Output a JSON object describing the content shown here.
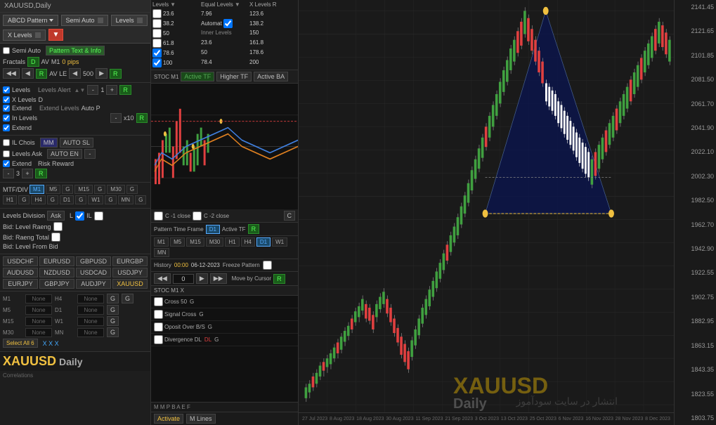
{
  "title": "XAUUSD,Daily",
  "toolbar": {
    "abcd_label": "ABCD Pattern",
    "semi_auto_label": "Semi Auto",
    "levels_label": "Levels",
    "x_levels_label": "X Levels"
  },
  "controls": {
    "semi_auto": "Semi Auto",
    "pattern_text": "Pattern Text & Info",
    "fractals": "Fractals",
    "fractals_d": "D",
    "av": "AV",
    "m1": "M1",
    "pips": "0 pips",
    "av_le": "AV LE",
    "av_le_val": "500",
    "levels": "Levels",
    "x_levels": "X Levels",
    "extend": "Extend",
    "in_levels": "In Levels",
    "extend2": "Extend",
    "il_chois": "IL Chois",
    "levels_ask": "Levels Ask",
    "extend3": "Extend",
    "levels_alert": "Levels Alert",
    "extend_levels": "Extend Levels",
    "auto_p": "Auto P",
    "mtf_div": "MTF/DIV",
    "m1_tf": "M1",
    "m5_tf": "M5",
    "m15_tf": "M15",
    "m30_tf": "M30",
    "h1_tf": "H1",
    "h4_tf": "H4",
    "d1_tf": "D1",
    "w1_tf": "W1",
    "mn_tf": "MN",
    "g_label": "G"
  },
  "levels_data": {
    "col1_header": "Levels",
    "col2_header": "Equal Levels",
    "col3_header": "X Levels",
    "col1_r": "R",
    "rows": [
      {
        "v1": "23.6",
        "v2": "7.96",
        "v3": "123.6"
      },
      {
        "v1": "38.2",
        "v2": "Automat",
        "v3": "138.2"
      },
      {
        "v1": "50",
        "v2": "",
        "v3": "150"
      },
      {
        "v1": "61.8",
        "v2": "23.6",
        "v3": "161.8"
      },
      {
        "v1": "78.6",
        "v2": "50",
        "v3": "178.6"
      },
      {
        "v1": "100",
        "v2": "78.4",
        "v3": "200"
      }
    ],
    "inner_levels": "Inner Levels"
  },
  "stoc": {
    "label": "STOC M1",
    "active_tf": "Active TF",
    "higher_tf": "Higher TF",
    "active_ba": "Active BA",
    "cross50": "Cross 50",
    "signal_cross": "Signal Cross",
    "oposit": "Oposit Over B/S",
    "divergence": "Divergence DL"
  },
  "pattern_tf": {
    "label": "Pattern Time Frame",
    "d1": "D1",
    "active_tf": "Active TF",
    "r": "R",
    "tfs": [
      "M1",
      "M5",
      "M15",
      "M30",
      "H1",
      "H4",
      "D1",
      "W1",
      "MN"
    ]
  },
  "history": {
    "label": "History",
    "time": "00:00",
    "date": "06-12-2023",
    "freeze": "Freeze Pattern",
    "move": "Move by Cursor",
    "r": "R"
  },
  "c_controls": {
    "c1": "C -1 close",
    "c2": "C -2 close",
    "c_label": "C"
  },
  "levels_division": {
    "label": "Levels Division",
    "ask": "Ask",
    "l": "L",
    "il": "IL"
  },
  "bid_levels": {
    "level_raeng": "Bid: Level Raeng",
    "raeng_total": "Bid: Raeng Total",
    "level_from": "Bid: Level From Bid"
  },
  "currencies": [
    [
      "USDCHF",
      "EURUSD",
      "GBPUSD",
      "EURGBP"
    ],
    [
      "AUDUSD",
      "NZDUSD",
      "USDCAD",
      "USDJPY"
    ],
    [
      "EURJPY",
      "GBPJPY",
      "AUDJPY",
      "XAUUSD"
    ]
  ],
  "indicators": {
    "rows": [
      {
        "tf": "M1",
        "left": "None",
        "tf2": "H4",
        "right": "None"
      },
      {
        "tf": "M5",
        "left": "None",
        "tf2": "D1",
        "right": "None"
      },
      {
        "tf": "M15",
        "left": "None",
        "tf2": "W1",
        "right": "None"
      },
      {
        "tf": "M30",
        "left": "None",
        "tf2": "MN",
        "right": "None"
      }
    ]
  },
  "select_all": "Select All 6",
  "mm_auto": "MM",
  "auto_sl": "AUTO SL",
  "auto_en": "AUTO EN",
  "risk_reward": "Risk Reward",
  "minus3": "-",
  "three": "3",
  "plus3": "+",
  "r3": "R",
  "prices": [
    "2141.45",
    "2121.65",
    "2101.85",
    "2081.50",
    "2061.70",
    "2041.90",
    "2022.10",
    "2002.30",
    "1982.50",
    "1962.70",
    "1942.90",
    "1922.55",
    "1902.75",
    "1882.95",
    "1863.15",
    "1843.35",
    "1823.55",
    "1803.75"
  ],
  "dates": [
    "27 Jul 2023",
    "8 Aug 2023",
    "18 Aug 2023",
    "30 Aug 2023",
    "11 Sep 2023",
    "21 Sep 2023",
    "3 Oct 2023",
    "13 Oct 2023",
    "25 Oct 2023",
    "6 Nov 2023",
    "16 Nov 2023",
    "28 Nov 2023",
    "8 Dec 2023"
  ],
  "watermark": "انتشار در سایت سود‌آموز",
  "correlations": "Correlations",
  "activate": "Activate",
  "m_lines": "M Lines",
  "stoc_m1_x": "STOC   M1   X",
  "m_p_b_a_e_f": "M  M  P  B  A  E  F"
}
